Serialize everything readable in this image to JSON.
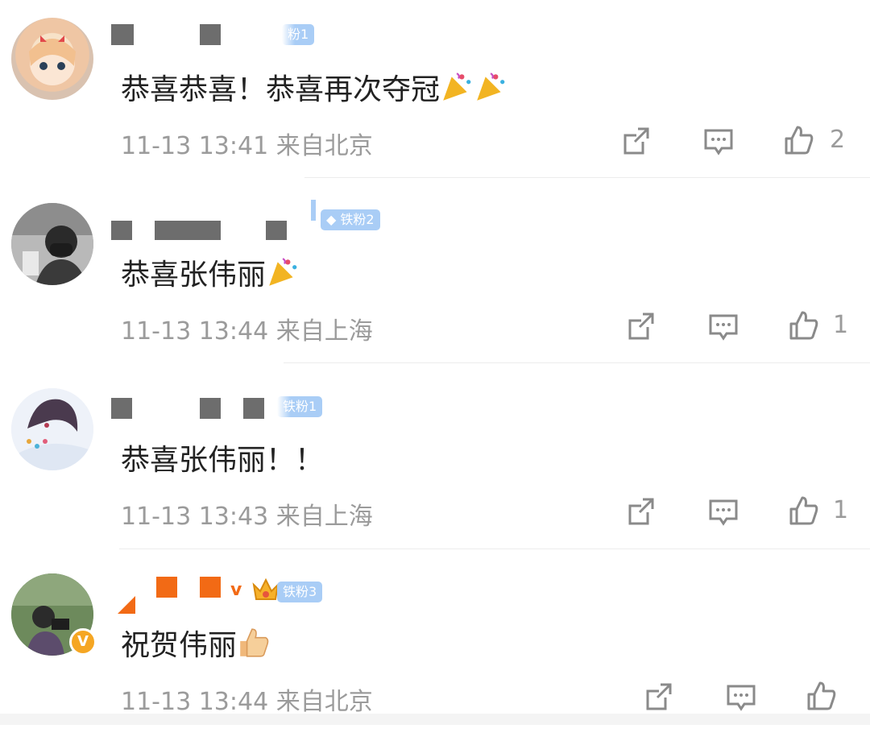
{
  "comments": [
    {
      "text": "恭喜恭喜！恭喜再次夺冠",
      "emoji": [
        "party-popper",
        "party-popper"
      ],
      "badge": "粉1",
      "time": "11-13 13:41",
      "location": "来自北京",
      "likes": "2"
    },
    {
      "text": "恭喜张伟丽",
      "emoji": [
        "party-popper"
      ],
      "badge": "铁粉2",
      "time": "11-13 13:44",
      "location": "来自上海",
      "likes": "1"
    },
    {
      "text": "恭喜张伟丽！！",
      "emoji": [],
      "badge": "铁粉1",
      "time": "11-13 13:43",
      "location": "来自上海",
      "likes": "1"
    },
    {
      "text": "祝贺伟丽",
      "emoji": [
        "thumbs-up"
      ],
      "badge": "铁粉3",
      "verified_mark": "v",
      "time": "11-13 13:44",
      "location": "来自北京",
      "likes": ""
    }
  ],
  "icons": {
    "share": "share-icon",
    "reply": "comment-icon",
    "like": "thumbs-up-icon"
  },
  "colors": {
    "accent": "#f26a15",
    "badge": "#a9cdf6",
    "meta": "#9b9b9b"
  }
}
